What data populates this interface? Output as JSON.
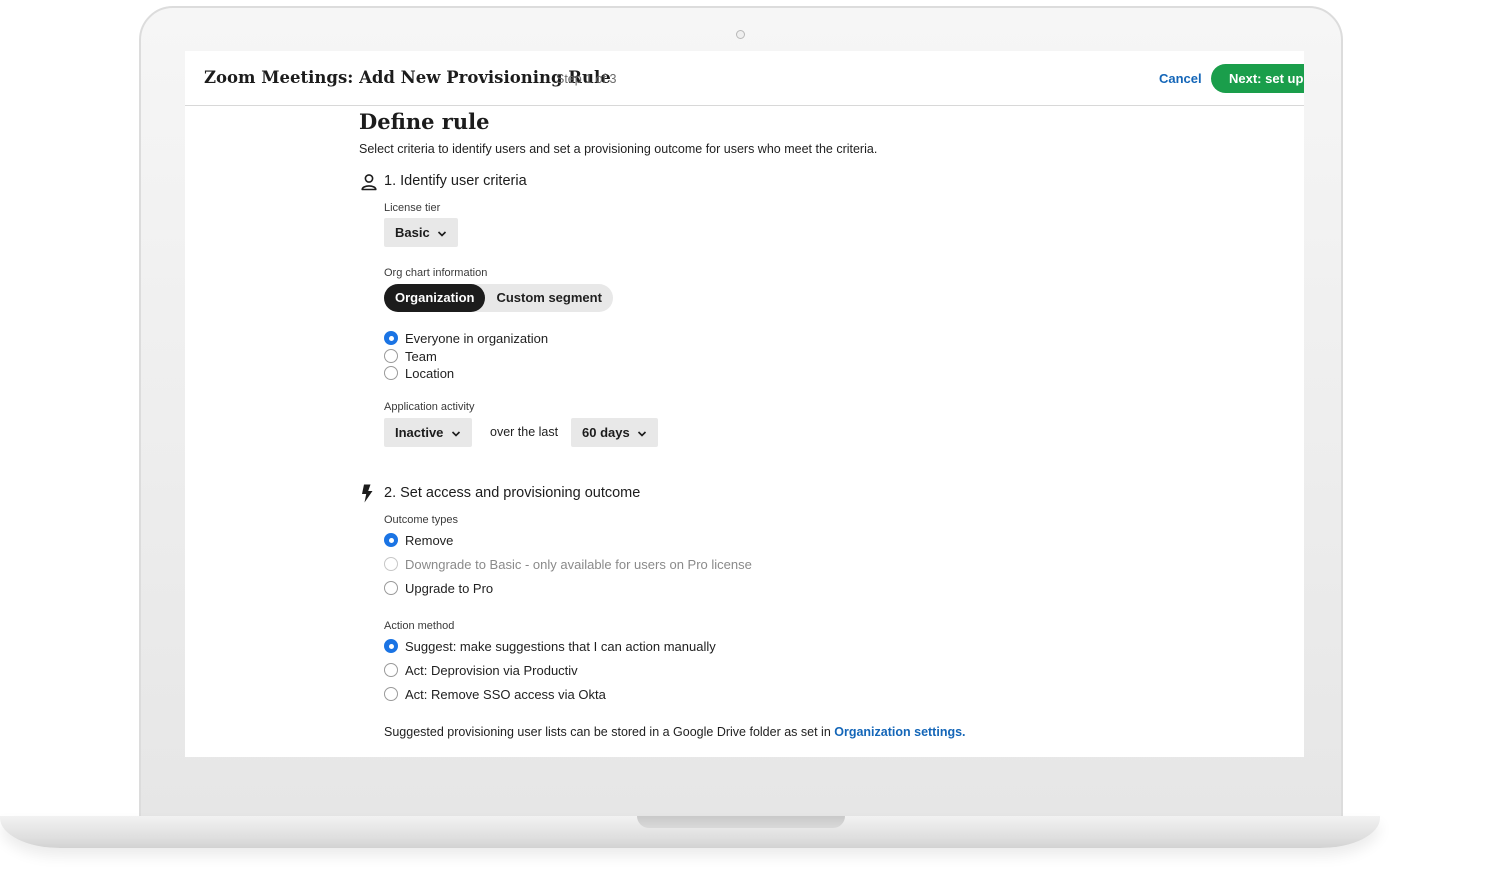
{
  "header": {
    "title": "Zoom Meetings: Add New Provisioning Rule",
    "step": "Step 1 of 3",
    "cancel_label": "Cancel",
    "next_label": "Next: set up u"
  },
  "page": {
    "heading": "Define rule",
    "subtitle": "Select criteria to identify users and set a provisioning outcome for users who meet the criteria."
  },
  "section1": {
    "title": "1. Identify user criteria",
    "icon": "person-icon",
    "license_tier": {
      "label": "License tier",
      "value": "Basic"
    },
    "org_chart": {
      "label": "Org chart information",
      "tabs": [
        {
          "label": "Organization",
          "active": true
        },
        {
          "label": "Custom segment",
          "active": false
        }
      ],
      "options": [
        {
          "label": "Everyone in organization",
          "checked": true
        },
        {
          "label": "Team",
          "checked": false
        },
        {
          "label": "Location",
          "checked": false
        }
      ]
    },
    "activity": {
      "label": "Application activity",
      "status": "Inactive",
      "connector": "over the last",
      "period": "60 days"
    }
  },
  "section2": {
    "title": "2. Set access and provisioning outcome",
    "icon": "lightning-icon",
    "outcome_types": {
      "label": "Outcome types",
      "options": [
        {
          "label": "Remove",
          "checked": true,
          "disabled": false
        },
        {
          "label": "Downgrade to Basic - only available for users on Pro license",
          "checked": false,
          "disabled": true
        },
        {
          "label": "Upgrade to Pro",
          "checked": false,
          "disabled": false
        }
      ]
    },
    "action_method": {
      "label": "Action method",
      "options": [
        {
          "label": "Suggest: make suggestions that I can action manually",
          "checked": true
        },
        {
          "label": "Act: Deprovision via Productiv",
          "checked": false
        },
        {
          "label": "Act: Remove SSO access via Okta",
          "checked": false
        }
      ]
    },
    "footnote": {
      "text": "Suggested provisioning user lists can be stored in a Google Drive folder as set in ",
      "link": "Organization settings."
    }
  },
  "colors": {
    "accent_green": "#1a9e4b",
    "link_blue": "#1466b8",
    "radio_blue": "#1b74e4"
  }
}
